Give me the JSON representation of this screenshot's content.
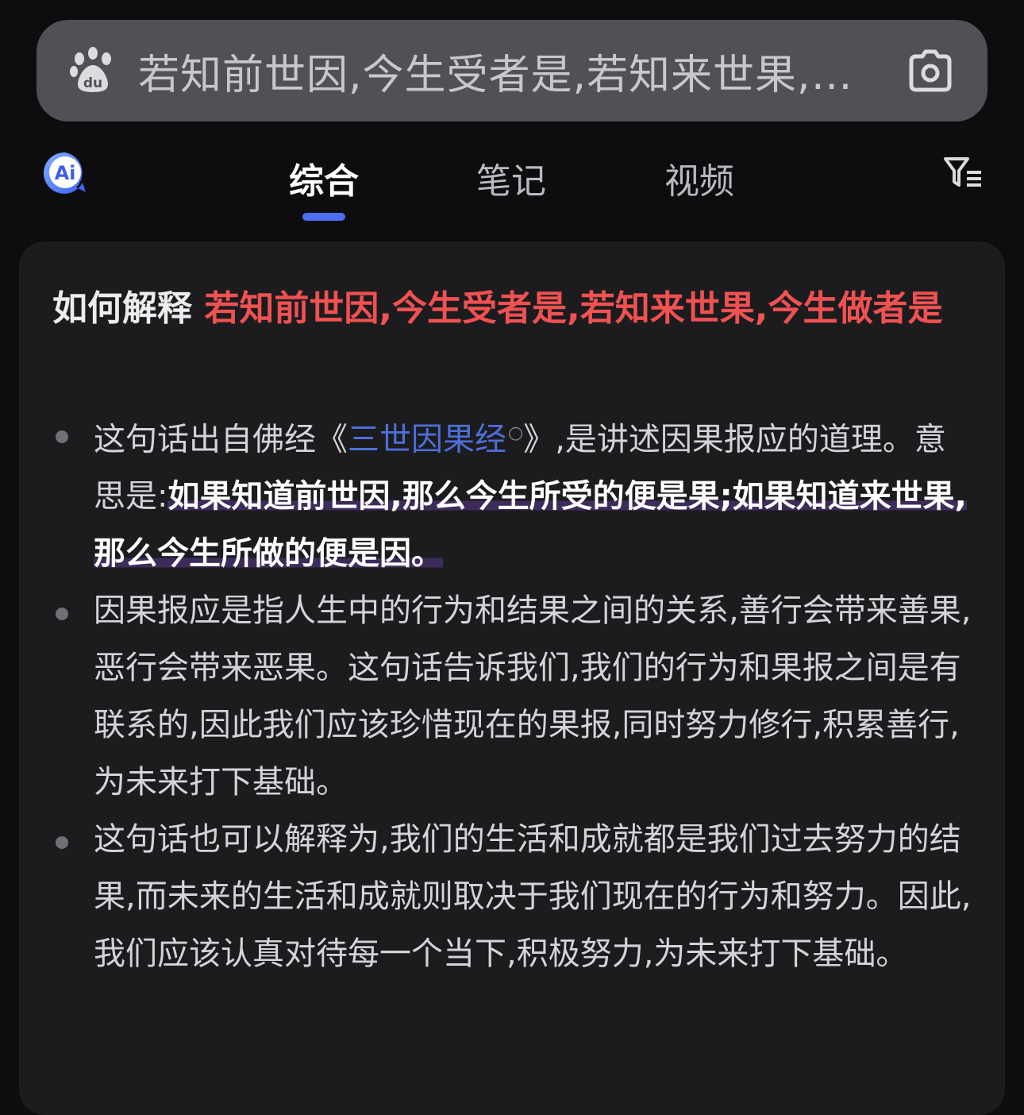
{
  "search": {
    "query": "若知前世因,今生受者是,若知来世果,今生做者是"
  },
  "tabs": [
    {
      "label": "综合"
    },
    {
      "label": "笔记"
    },
    {
      "label": "视频"
    }
  ],
  "colors": {
    "accent": "#4e6ef2",
    "highlight": "#f05151",
    "link": "#4f6fd8"
  },
  "answer": {
    "title_prefix": "如何解释 ",
    "title_highlight": "若知前世因,今生受者是,若知来世果,今生做者是",
    "bullets": [
      {
        "pre": "这句话出自佛经《",
        "link": "三世因果经",
        "post": "》,是讲述因果报应的道理。意思是:",
        "emphasis": "如果知道前世因,那么今生所受的便是果;如果知道来世果,那么今生所做的便是因。"
      },
      {
        "text": "因果报应是指人生中的行为和结果之间的关系,善行会带来善果,恶行会带来恶果。这句话告诉我们,我们的行为和果报之间是有联系的,因此我们应该珍惜现在的果报,同时努力修行,积累善行,为未来打下基础。"
      },
      {
        "text": "这句话也可以解释为,我们的生活和成就都是我们过去努力的结果,而未来的生活和成就则取决于我们现在的行为和努力。因此,我们应该认真对待每一个当下,积极努力,为未来打下基础。"
      }
    ]
  }
}
